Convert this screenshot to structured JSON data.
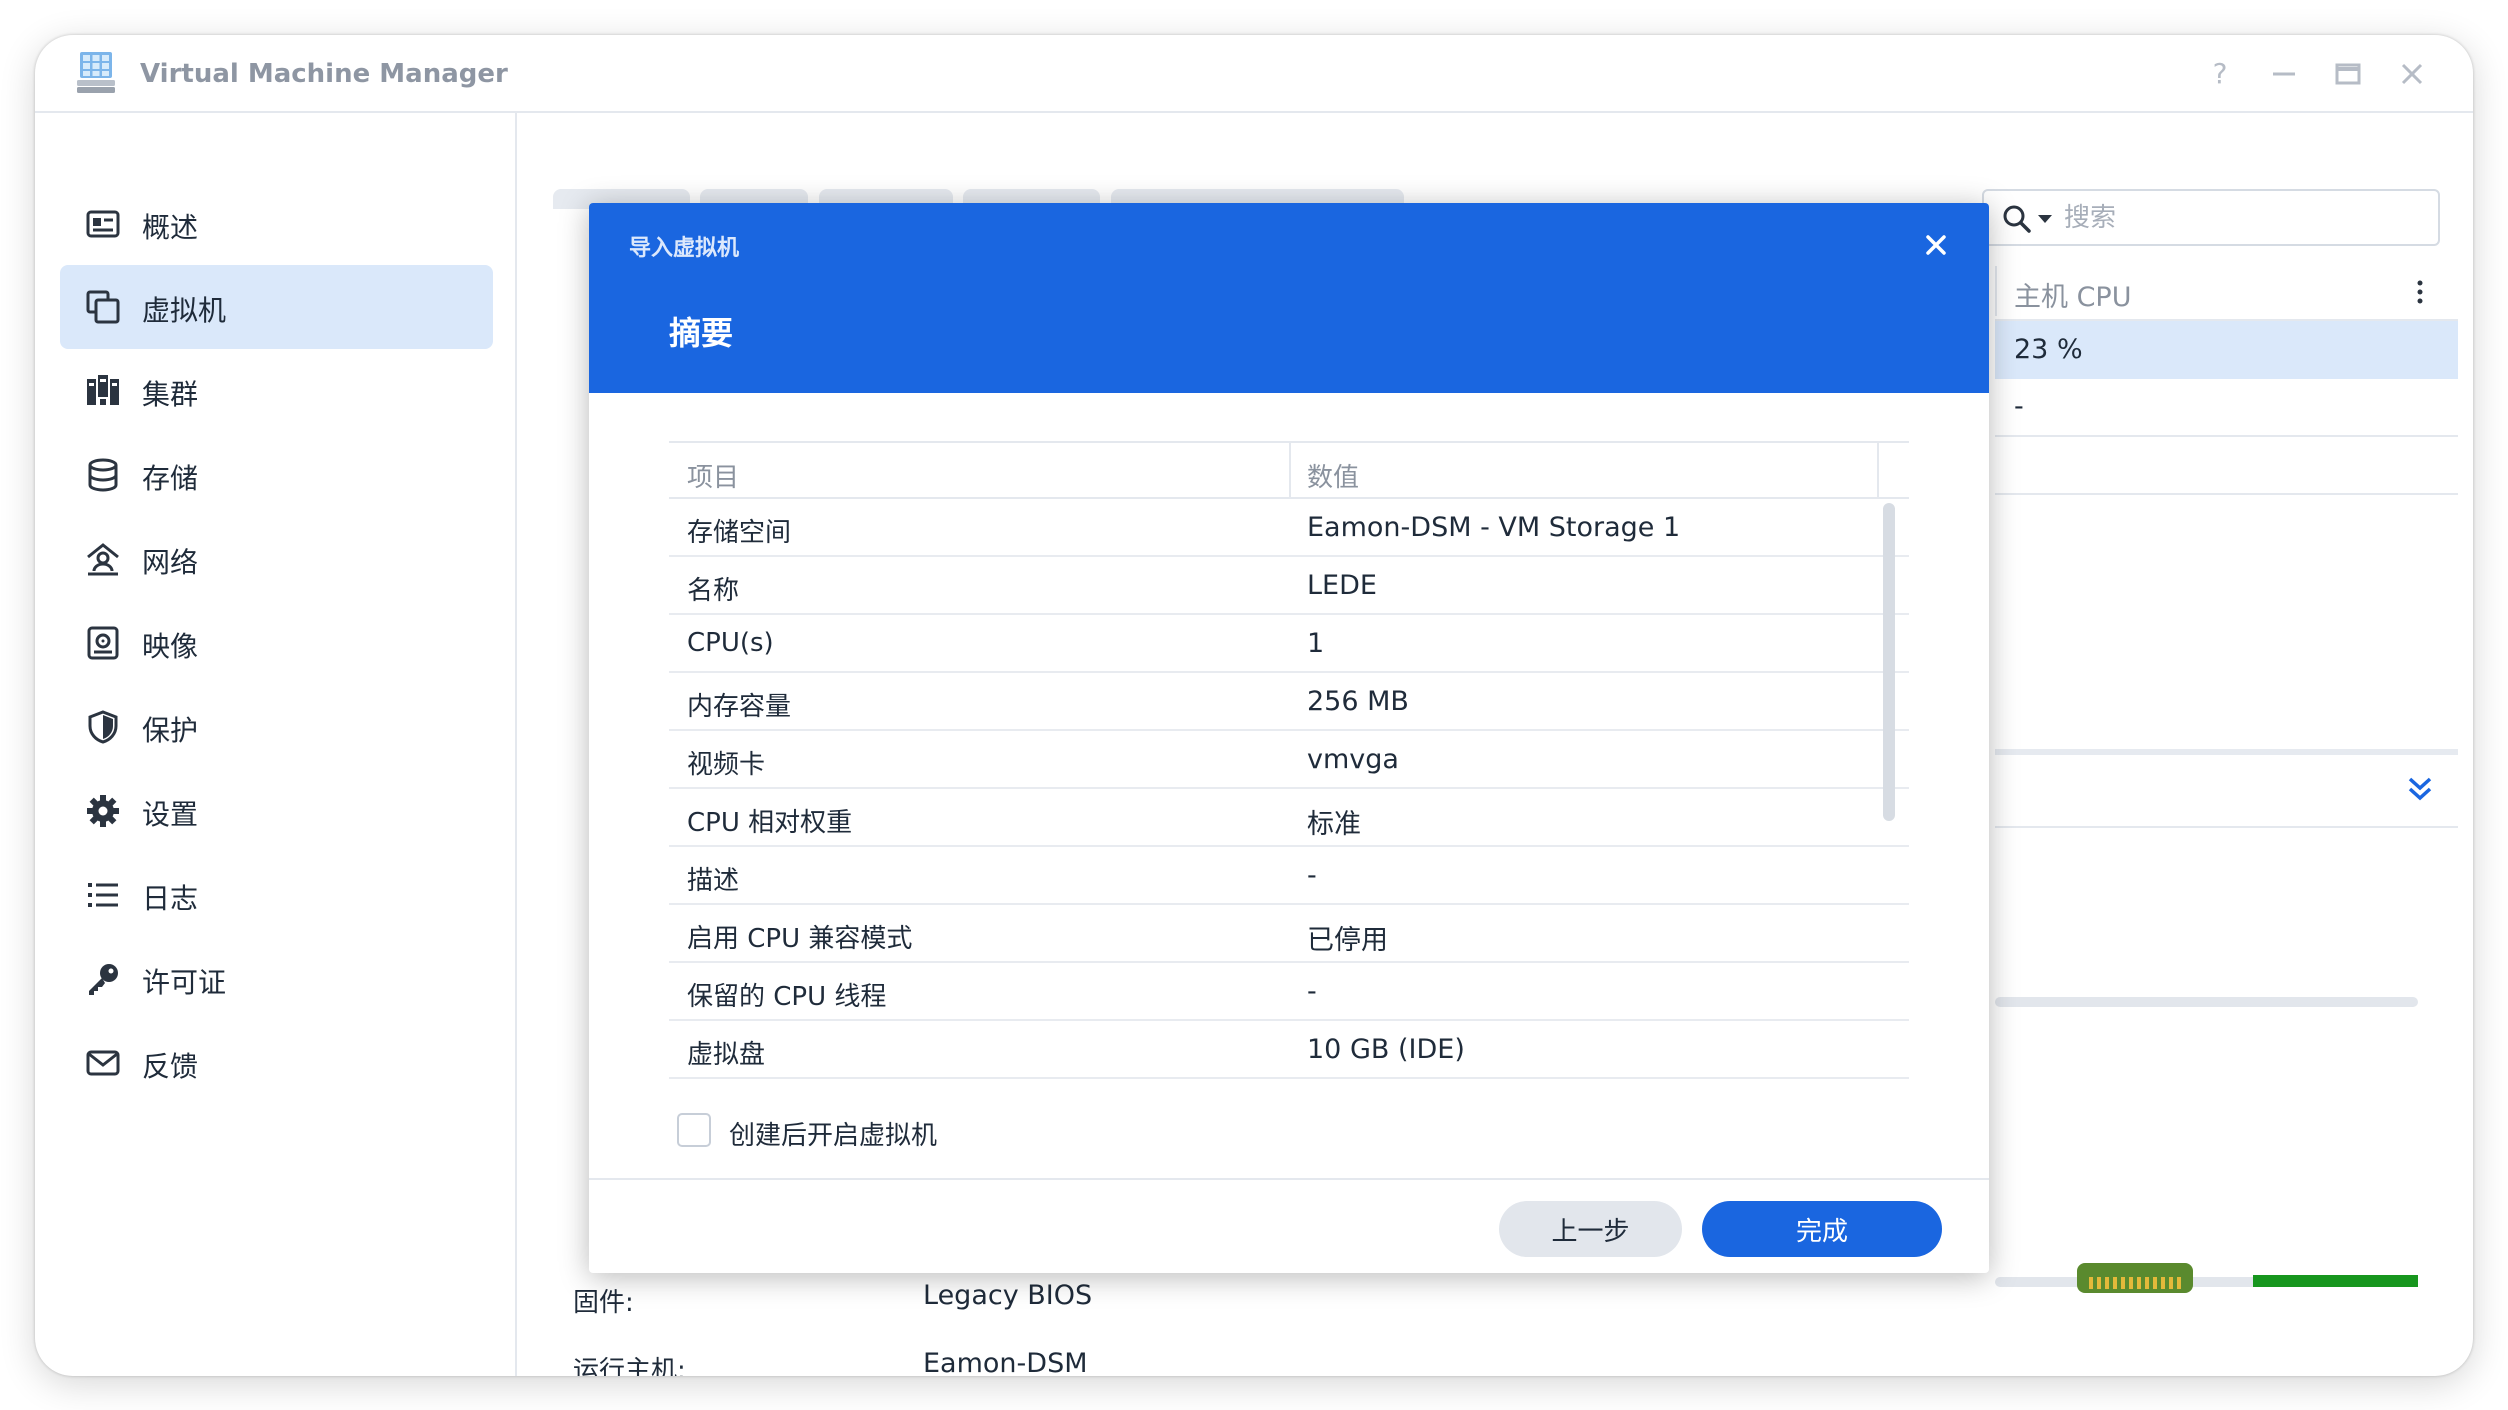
{
  "app": {
    "title": "Virtual Machine Manager"
  },
  "window_controls": {
    "help": "?"
  },
  "sidebar": {
    "items": [
      {
        "label": "概述",
        "icon": "overview-icon"
      },
      {
        "label": "虚拟机",
        "icon": "virtual-machine-icon",
        "active": true
      },
      {
        "label": "集群",
        "icon": "cluster-icon"
      },
      {
        "label": "存储",
        "icon": "storage-icon"
      },
      {
        "label": "网络",
        "icon": "network-icon"
      },
      {
        "label": "映像",
        "icon": "image-icon"
      },
      {
        "label": "保护",
        "icon": "shield-icon"
      },
      {
        "label": "设置",
        "icon": "gear-icon"
      },
      {
        "label": "日志",
        "icon": "log-list-icon"
      },
      {
        "label": "许可证",
        "icon": "key-icon"
      },
      {
        "label": "反馈",
        "icon": "mail-icon"
      }
    ]
  },
  "search": {
    "placeholder": "搜索",
    "value": ""
  },
  "background_table": {
    "column_title": "主机 CPU",
    "rows": [
      "23 %",
      "-"
    ]
  },
  "vm_info": {
    "firmware_label": "固件:",
    "firmware_value": "Legacy BIOS",
    "host_label": "运行主机:",
    "host_value": "Eamon-DSM"
  },
  "modal": {
    "small_title": "导入虚拟机",
    "title": "摘要",
    "columns": [
      "项目",
      "数值"
    ],
    "rows": [
      {
        "key": "存储空间",
        "value": "Eamon-DSM - VM Storage 1"
      },
      {
        "key": "名称",
        "value": "LEDE"
      },
      {
        "key": "CPU(s)",
        "value": "1"
      },
      {
        "key": "内存容量",
        "value": "256 MB"
      },
      {
        "key": "视频卡",
        "value": "vmvga"
      },
      {
        "key": "CPU 相对权重",
        "value": "标准"
      },
      {
        "key": "描述",
        "value": "-"
      },
      {
        "key": "启用 CPU 兼容模式",
        "value": "已停用"
      },
      {
        "key": "保留的 CPU 线程",
        "value": "-"
      },
      {
        "key": "虚拟盘",
        "value": "10 GB (IDE)"
      }
    ],
    "checkbox_label": "创建后开启虚拟机",
    "checkbox_checked": false,
    "prev_button": "上一步",
    "done_button": "完成"
  },
  "colors": {
    "accent": "#1a66e0",
    "sidebar_active": "#dae8fa",
    "progress_fill": "#17961e"
  }
}
